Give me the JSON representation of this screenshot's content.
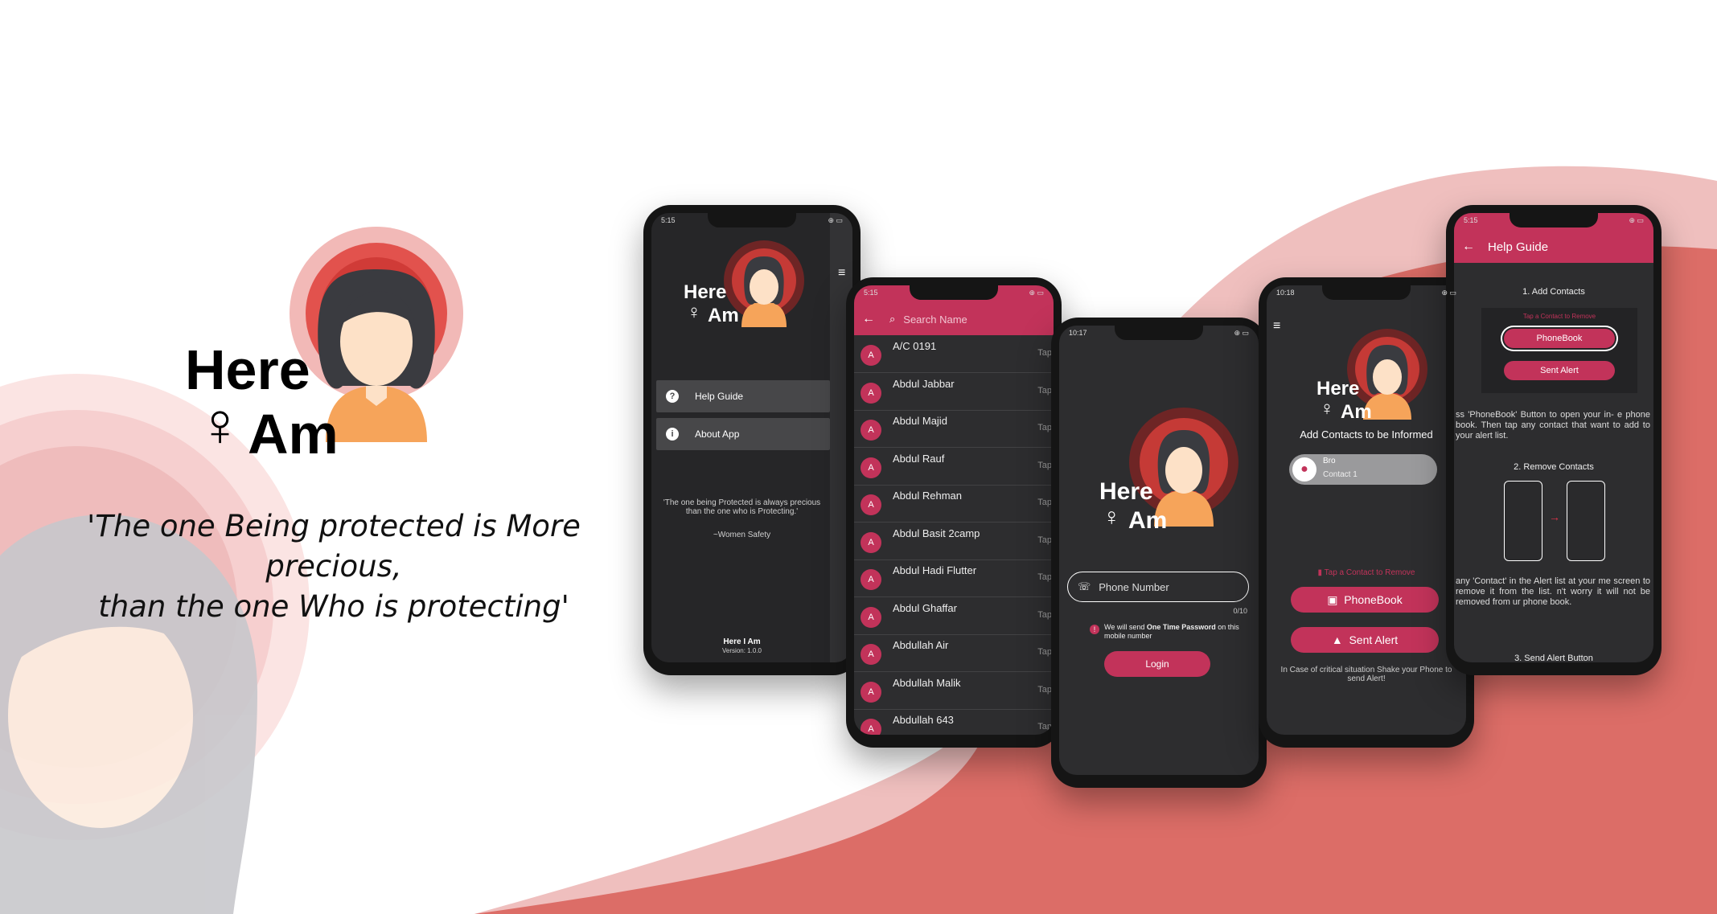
{
  "colors": {
    "accent": "#c2335a",
    "bg_pink": "#efbfbe",
    "bg_red": "#dc6d67",
    "phone_screen": "#2d2d2f"
  },
  "brand": {
    "title_line1": "Here",
    "title_line2": "Am",
    "female_symbol": "♀"
  },
  "tagline": {
    "line1": "'The one Being protected is More precious,",
    "line2": "than the one Who is protecting'"
  },
  "phone1": {
    "status": "5:15",
    "menu_icon": "hamburger-icon",
    "logo_line1": "Here",
    "logo_line2": "Am",
    "items": [
      {
        "icon": "question-icon",
        "label": "Help Guide"
      },
      {
        "icon": "info-icon",
        "label": "About App"
      }
    ],
    "quote": "'The one being Protected is always precious than the one who is Protecting.'",
    "quote_author": "~Women Safety",
    "footer_title": "Here I Am",
    "footer_version": "Version: 1.0.0"
  },
  "phone2": {
    "status": "5:15",
    "search_placeholder": "Search Name",
    "tap_label": "Tap",
    "contacts": [
      {
        "initial": "A",
        "name": "A/C 0191"
      },
      {
        "initial": "A",
        "name": "Abdul Jabbar"
      },
      {
        "initial": "A",
        "name": "Abdul Majid"
      },
      {
        "initial": "A",
        "name": "Abdul Rauf"
      },
      {
        "initial": "A",
        "name": "Abdul Rehman"
      },
      {
        "initial": "A",
        "name": "Abdul Basit 2camp"
      },
      {
        "initial": "A",
        "name": "Abdul Hadi Flutter"
      },
      {
        "initial": "A",
        "name": "Abdul Ghaffar"
      },
      {
        "initial": "A",
        "name": "Abdullah Air"
      },
      {
        "initial": "A",
        "name": "Abdullah Malik"
      },
      {
        "initial": "A",
        "name": "Abdullah 643"
      }
    ]
  },
  "phone3": {
    "status": "10:17",
    "logo_line1": "Here",
    "logo_line2": "Am",
    "phone_placeholder": "Phone Number",
    "counter": "0/10",
    "otp_prefix": "We will send ",
    "otp_bold": "One Time Password",
    "otp_suffix": " on this mobile number",
    "login": "Login"
  },
  "phone4": {
    "status": "10:18",
    "logo_line1": "Here",
    "logo_line2": "Am",
    "heading": "Add Contacts to be Informed",
    "contact_name": "Bro",
    "contact_sub": "Contact 1",
    "remove_hint": "Tap a Contact to Remove",
    "phonebook": "PhoneBook",
    "sent_alert": "Sent Alert",
    "shake_text": "In Case of critical situation Shake your Phone to send Alert!"
  },
  "phone5": {
    "status": "5:15",
    "title": "Help Guide",
    "step1": "1. Add Contacts",
    "remove_hint": "Tap a Contact to Remove",
    "phonebook": "PhoneBook",
    "sent_alert": "Sent Alert",
    "para1": "ss 'PhoneBook' Button to open your in- e phone book. Then tap any contact that want to add to your alert list.",
    "step2": "2. Remove Contacts",
    "para2": "any 'Contact' in the Alert list at your me screen to remove it from the list. n't worry it will not be removed from ur phone book.",
    "step3": "3. Send Alert Button"
  }
}
